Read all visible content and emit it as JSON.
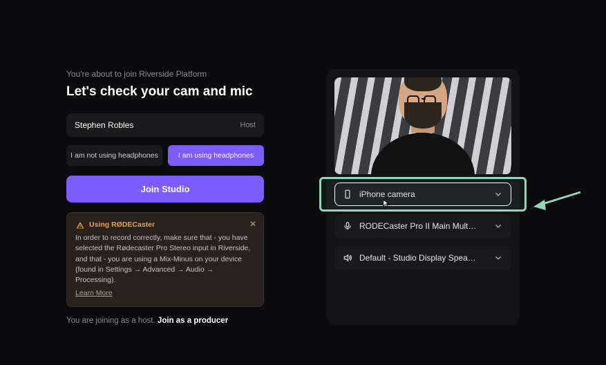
{
  "left": {
    "subtitle": "You're about to join Riverside Platform",
    "title": "Let's check your cam and mic",
    "name": "Stephen Robles",
    "role": "Host",
    "headphones": {
      "not_using": "I am not using headphones",
      "using": "I am using headphones"
    },
    "join": "Join Studio",
    "alert": {
      "title": "Using RØDECaster",
      "body": "In order to record correctly, make sure that - you have selected the Rødecaster Pro Stereo input in Riverside, and that - you are using a Mix-Minus on your device (found in Settings → Advanced → Audio → Processing).",
      "learn": "Learn More"
    },
    "footer_prefix": "You are joining as a host. ",
    "footer_link": "Join as a producer"
  },
  "devices": {
    "camera": "iPhone camera",
    "mic": "RODECaster Pro II Main Multitrack…",
    "speaker": "Default - Studio Display Speakers …"
  }
}
